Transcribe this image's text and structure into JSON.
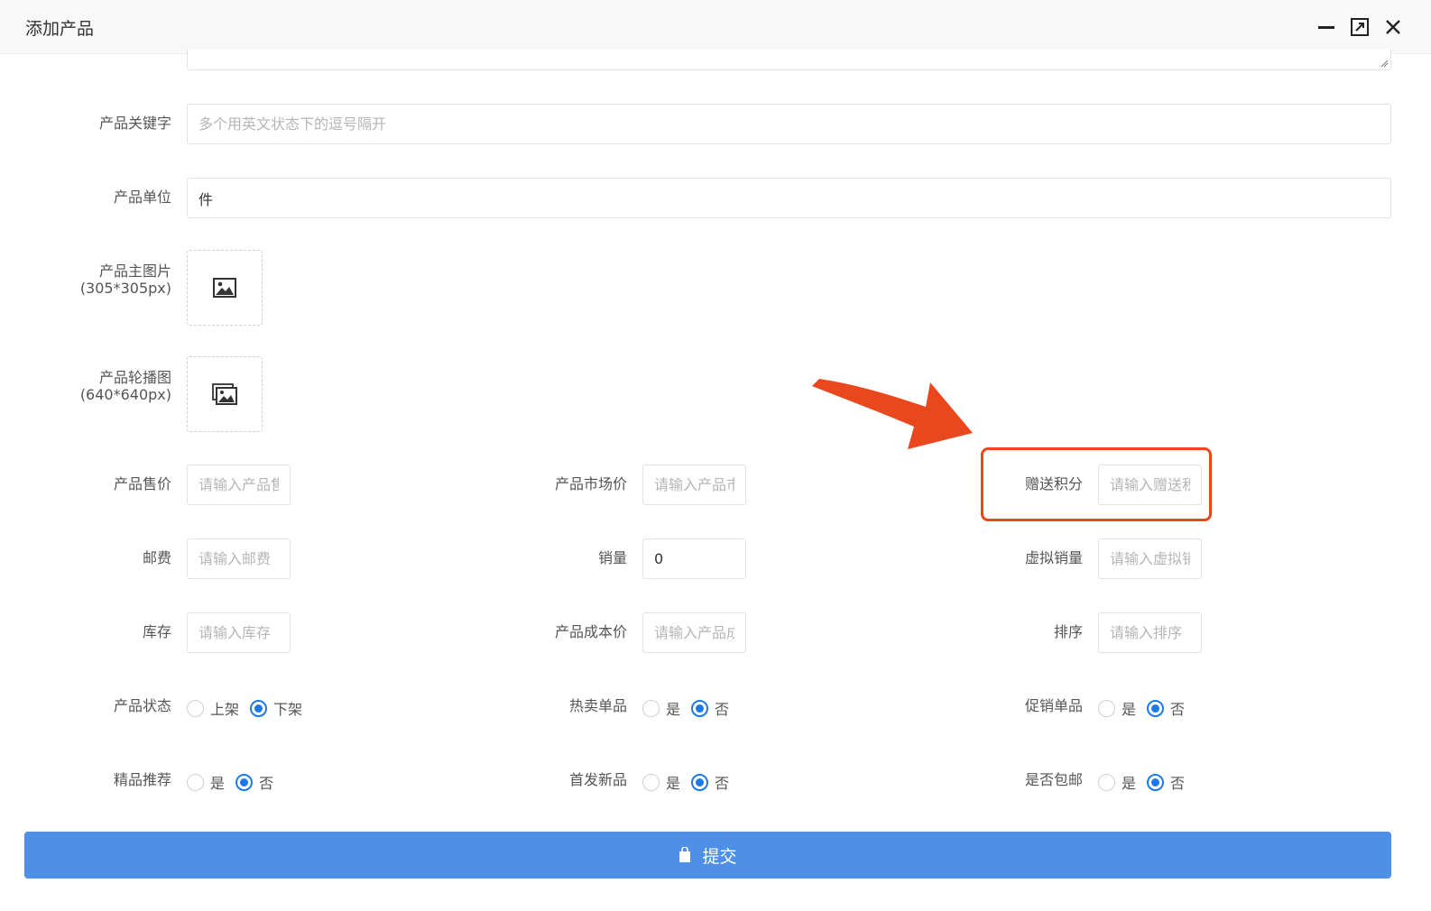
{
  "window": {
    "title": "添加产品",
    "controls": [
      "minimize-icon",
      "maximize-icon",
      "close-icon"
    ]
  },
  "form": {
    "keywords": {
      "label": "产品关键字",
      "placeholder": "多个用英文状态下的逗号隔开",
      "value": ""
    },
    "unit": {
      "label": "产品单位",
      "value": "件"
    },
    "main_image": {
      "label_line1": "产品主图片",
      "label_line2": "(305*305px)",
      "icon": "image-icon"
    },
    "carousel": {
      "label_line1": "产品轮播图",
      "label_line2": "(640*640px)",
      "icon": "images-icon"
    },
    "price": {
      "label": "产品售价",
      "placeholder": "请输入产品售价"
    },
    "market_price": {
      "label": "产品市场价",
      "placeholder": "请输入产品市场价"
    },
    "points": {
      "label": "赠送积分",
      "placeholder": "请输入赠送积分"
    },
    "postage": {
      "label": "邮费",
      "placeholder": "请输入邮费"
    },
    "sales": {
      "label": "销量",
      "value": "0"
    },
    "virtual_sales": {
      "label": "虚拟销量",
      "placeholder": "请输入虚拟销量"
    },
    "stock": {
      "label": "库存",
      "placeholder": "请输入库存"
    },
    "cost_price": {
      "label": "产品成本价",
      "placeholder": "请输入产品成本价"
    },
    "sort": {
      "label": "排序",
      "placeholder": "请输入排序"
    },
    "status": {
      "label": "产品状态",
      "options": [
        "上架",
        "下架"
      ],
      "selected": "下架"
    },
    "hot": {
      "label": "热卖单品",
      "options": [
        "是",
        "否"
      ],
      "selected": "否"
    },
    "promo": {
      "label": "促销单品",
      "options": [
        "是",
        "否"
      ],
      "selected": "否"
    },
    "boutique": {
      "label": "精品推荐",
      "options": [
        "是",
        "否"
      ],
      "selected": "否"
    },
    "new_first": {
      "label": "首发新品",
      "options": [
        "是",
        "否"
      ],
      "selected": "否"
    },
    "free_shipping": {
      "label": "是否包邮",
      "options": [
        "是",
        "否"
      ],
      "selected": "否"
    }
  },
  "submit": {
    "label": "提交",
    "icon": "bag-icon"
  },
  "annotation": {
    "color": "#e9481f"
  },
  "colors": {
    "primary": "#4e8fe8",
    "radio_active": "#1e79e8"
  }
}
